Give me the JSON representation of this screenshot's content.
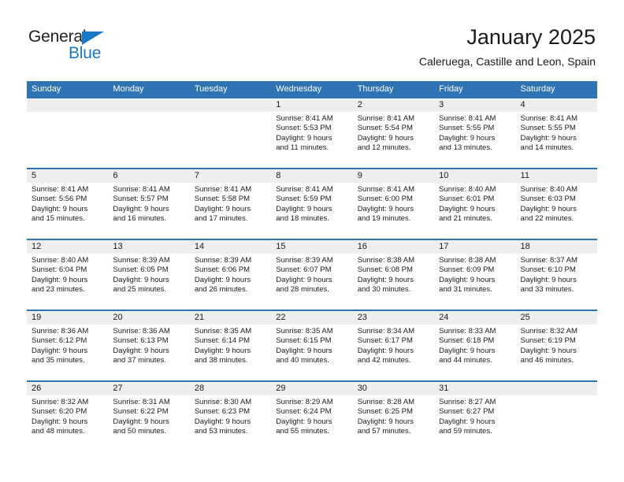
{
  "brand": {
    "line1": "General",
    "line2": "Blue",
    "accent_color": "#1878c4"
  },
  "header": {
    "title": "January 2025",
    "subtitle": "Caleruega, Castille and Leon, Spain"
  },
  "theme": {
    "header_bar_color": "#2e74b5",
    "week_divider_color": "#2e74b5",
    "daynum_band_color": "#eeeeee",
    "text_color": "#1a1a1a"
  },
  "calendar": {
    "weekday_headers": [
      "Sunday",
      "Monday",
      "Tuesday",
      "Wednesday",
      "Thursday",
      "Friday",
      "Saturday"
    ],
    "weeks": [
      [
        {
          "day": ""
        },
        {
          "day": ""
        },
        {
          "day": ""
        },
        {
          "day": "1",
          "sunrise": "Sunrise: 8:41 AM",
          "sunset": "Sunset: 5:53 PM",
          "daylight_1": "Daylight: 9 hours",
          "daylight_2": "and 11 minutes."
        },
        {
          "day": "2",
          "sunrise": "Sunrise: 8:41 AM",
          "sunset": "Sunset: 5:54 PM",
          "daylight_1": "Daylight: 9 hours",
          "daylight_2": "and 12 minutes."
        },
        {
          "day": "3",
          "sunrise": "Sunrise: 8:41 AM",
          "sunset": "Sunset: 5:55 PM",
          "daylight_1": "Daylight: 9 hours",
          "daylight_2": "and 13 minutes."
        },
        {
          "day": "4",
          "sunrise": "Sunrise: 8:41 AM",
          "sunset": "Sunset: 5:55 PM",
          "daylight_1": "Daylight: 9 hours",
          "daylight_2": "and 14 minutes."
        }
      ],
      [
        {
          "day": "5",
          "sunrise": "Sunrise: 8:41 AM",
          "sunset": "Sunset: 5:56 PM",
          "daylight_1": "Daylight: 9 hours",
          "daylight_2": "and 15 minutes."
        },
        {
          "day": "6",
          "sunrise": "Sunrise: 8:41 AM",
          "sunset": "Sunset: 5:57 PM",
          "daylight_1": "Daylight: 9 hours",
          "daylight_2": "and 16 minutes."
        },
        {
          "day": "7",
          "sunrise": "Sunrise: 8:41 AM",
          "sunset": "Sunset: 5:58 PM",
          "daylight_1": "Daylight: 9 hours",
          "daylight_2": "and 17 minutes."
        },
        {
          "day": "8",
          "sunrise": "Sunrise: 8:41 AM",
          "sunset": "Sunset: 5:59 PM",
          "daylight_1": "Daylight: 9 hours",
          "daylight_2": "and 18 minutes."
        },
        {
          "day": "9",
          "sunrise": "Sunrise: 8:41 AM",
          "sunset": "Sunset: 6:00 PM",
          "daylight_1": "Daylight: 9 hours",
          "daylight_2": "and 19 minutes."
        },
        {
          "day": "10",
          "sunrise": "Sunrise: 8:40 AM",
          "sunset": "Sunset: 6:01 PM",
          "daylight_1": "Daylight: 9 hours",
          "daylight_2": "and 21 minutes."
        },
        {
          "day": "11",
          "sunrise": "Sunrise: 8:40 AM",
          "sunset": "Sunset: 6:03 PM",
          "daylight_1": "Daylight: 9 hours",
          "daylight_2": "and 22 minutes."
        }
      ],
      [
        {
          "day": "12",
          "sunrise": "Sunrise: 8:40 AM",
          "sunset": "Sunset: 6:04 PM",
          "daylight_1": "Daylight: 9 hours",
          "daylight_2": "and 23 minutes."
        },
        {
          "day": "13",
          "sunrise": "Sunrise: 8:39 AM",
          "sunset": "Sunset: 6:05 PM",
          "daylight_1": "Daylight: 9 hours",
          "daylight_2": "and 25 minutes."
        },
        {
          "day": "14",
          "sunrise": "Sunrise: 8:39 AM",
          "sunset": "Sunset: 6:06 PM",
          "daylight_1": "Daylight: 9 hours",
          "daylight_2": "and 26 minutes."
        },
        {
          "day": "15",
          "sunrise": "Sunrise: 8:39 AM",
          "sunset": "Sunset: 6:07 PM",
          "daylight_1": "Daylight: 9 hours",
          "daylight_2": "and 28 minutes."
        },
        {
          "day": "16",
          "sunrise": "Sunrise: 8:38 AM",
          "sunset": "Sunset: 6:08 PM",
          "daylight_1": "Daylight: 9 hours",
          "daylight_2": "and 30 minutes."
        },
        {
          "day": "17",
          "sunrise": "Sunrise: 8:38 AM",
          "sunset": "Sunset: 6:09 PM",
          "daylight_1": "Daylight: 9 hours",
          "daylight_2": "and 31 minutes."
        },
        {
          "day": "18",
          "sunrise": "Sunrise: 8:37 AM",
          "sunset": "Sunset: 6:10 PM",
          "daylight_1": "Daylight: 9 hours",
          "daylight_2": "and 33 minutes."
        }
      ],
      [
        {
          "day": "19",
          "sunrise": "Sunrise: 8:36 AM",
          "sunset": "Sunset: 6:12 PM",
          "daylight_1": "Daylight: 9 hours",
          "daylight_2": "and 35 minutes."
        },
        {
          "day": "20",
          "sunrise": "Sunrise: 8:36 AM",
          "sunset": "Sunset: 6:13 PM",
          "daylight_1": "Daylight: 9 hours",
          "daylight_2": "and 37 minutes."
        },
        {
          "day": "21",
          "sunrise": "Sunrise: 8:35 AM",
          "sunset": "Sunset: 6:14 PM",
          "daylight_1": "Daylight: 9 hours",
          "daylight_2": "and 38 minutes."
        },
        {
          "day": "22",
          "sunrise": "Sunrise: 8:35 AM",
          "sunset": "Sunset: 6:15 PM",
          "daylight_1": "Daylight: 9 hours",
          "daylight_2": "and 40 minutes."
        },
        {
          "day": "23",
          "sunrise": "Sunrise: 8:34 AM",
          "sunset": "Sunset: 6:17 PM",
          "daylight_1": "Daylight: 9 hours",
          "daylight_2": "and 42 minutes."
        },
        {
          "day": "24",
          "sunrise": "Sunrise: 8:33 AM",
          "sunset": "Sunset: 6:18 PM",
          "daylight_1": "Daylight: 9 hours",
          "daylight_2": "and 44 minutes."
        },
        {
          "day": "25",
          "sunrise": "Sunrise: 8:32 AM",
          "sunset": "Sunset: 6:19 PM",
          "daylight_1": "Daylight: 9 hours",
          "daylight_2": "and 46 minutes."
        }
      ],
      [
        {
          "day": "26",
          "sunrise": "Sunrise: 8:32 AM",
          "sunset": "Sunset: 6:20 PM",
          "daylight_1": "Daylight: 9 hours",
          "daylight_2": "and 48 minutes."
        },
        {
          "day": "27",
          "sunrise": "Sunrise: 8:31 AM",
          "sunset": "Sunset: 6:22 PM",
          "daylight_1": "Daylight: 9 hours",
          "daylight_2": "and 50 minutes."
        },
        {
          "day": "28",
          "sunrise": "Sunrise: 8:30 AM",
          "sunset": "Sunset: 6:23 PM",
          "daylight_1": "Daylight: 9 hours",
          "daylight_2": "and 53 minutes."
        },
        {
          "day": "29",
          "sunrise": "Sunrise: 8:29 AM",
          "sunset": "Sunset: 6:24 PM",
          "daylight_1": "Daylight: 9 hours",
          "daylight_2": "and 55 minutes."
        },
        {
          "day": "30",
          "sunrise": "Sunrise: 8:28 AM",
          "sunset": "Sunset: 6:25 PM",
          "daylight_1": "Daylight: 9 hours",
          "daylight_2": "and 57 minutes."
        },
        {
          "day": "31",
          "sunrise": "Sunrise: 8:27 AM",
          "sunset": "Sunset: 6:27 PM",
          "daylight_1": "Daylight: 9 hours",
          "daylight_2": "and 59 minutes."
        },
        {
          "day": ""
        }
      ]
    ]
  }
}
